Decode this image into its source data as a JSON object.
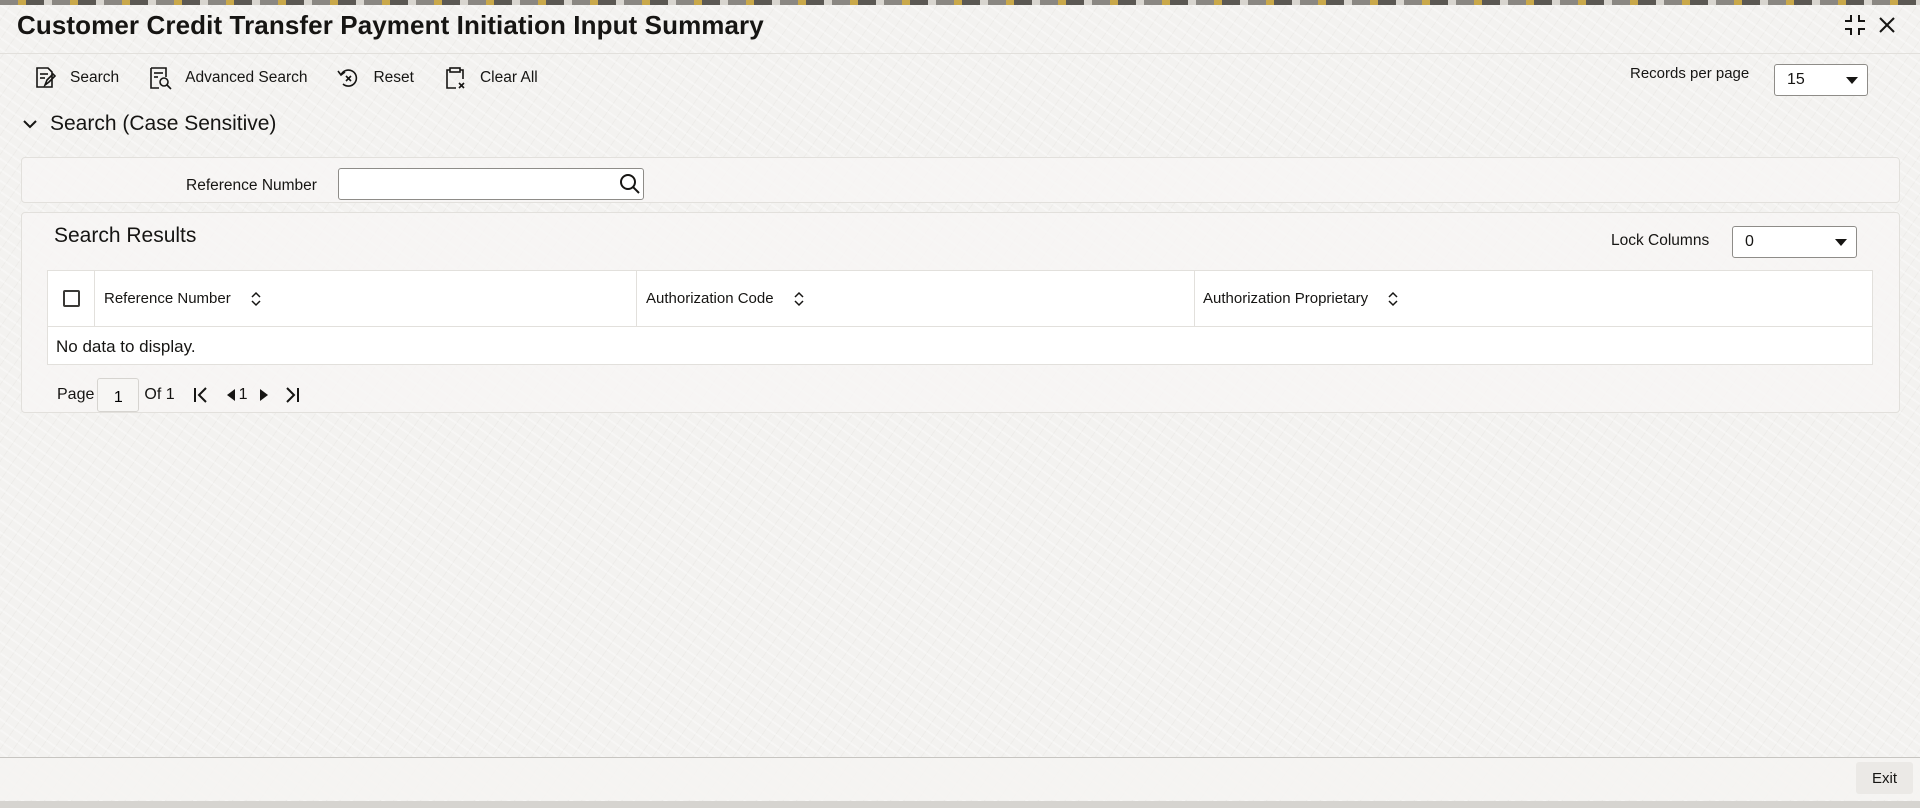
{
  "window": {
    "title": "Customer Credit Transfer Payment Initiation Input Summary",
    "controls": [
      "restore-icon",
      "close-icon"
    ]
  },
  "toolbar": {
    "search_label": "Search",
    "advanced_search_label": "Advanced Search",
    "reset_label": "Reset",
    "clear_all_label": "Clear All"
  },
  "records_per_page": {
    "label": "Records per page",
    "value": "15"
  },
  "search_section": {
    "title": "Search (Case Sensitive)",
    "fields": {
      "reference_number_label": "Reference Number",
      "reference_number_value": ""
    }
  },
  "results": {
    "title": "Search Results",
    "lock_columns_label": "Lock Columns",
    "lock_columns_value": "0",
    "columns": [
      "Reference Number",
      "Authorization Code",
      "Authorization Proprietary"
    ],
    "rows": [],
    "empty_text": "No data to display."
  },
  "pagination": {
    "page_label": "Page",
    "current_page": "1",
    "of_label": "Of 1",
    "page_number": "1"
  },
  "footer": {
    "exit_label": "Exit"
  }
}
